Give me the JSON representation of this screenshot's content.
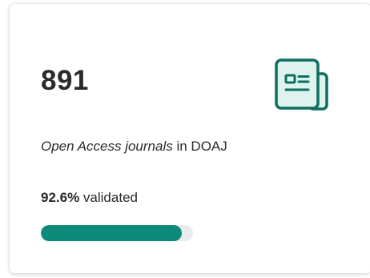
{
  "card": {
    "count": "891",
    "description_emphasis": "Open Access journals",
    "description_rest": " in DOAJ",
    "validated_percent_text": "92.6%",
    "validated_label": " validated",
    "progress_fraction": 0.926,
    "icon": "journal-icon"
  },
  "colors": {
    "accent": "#0e8a7b",
    "icon_fill": "#dff3ee",
    "icon_stroke": "#0e6e60",
    "track": "#e9ecef"
  }
}
